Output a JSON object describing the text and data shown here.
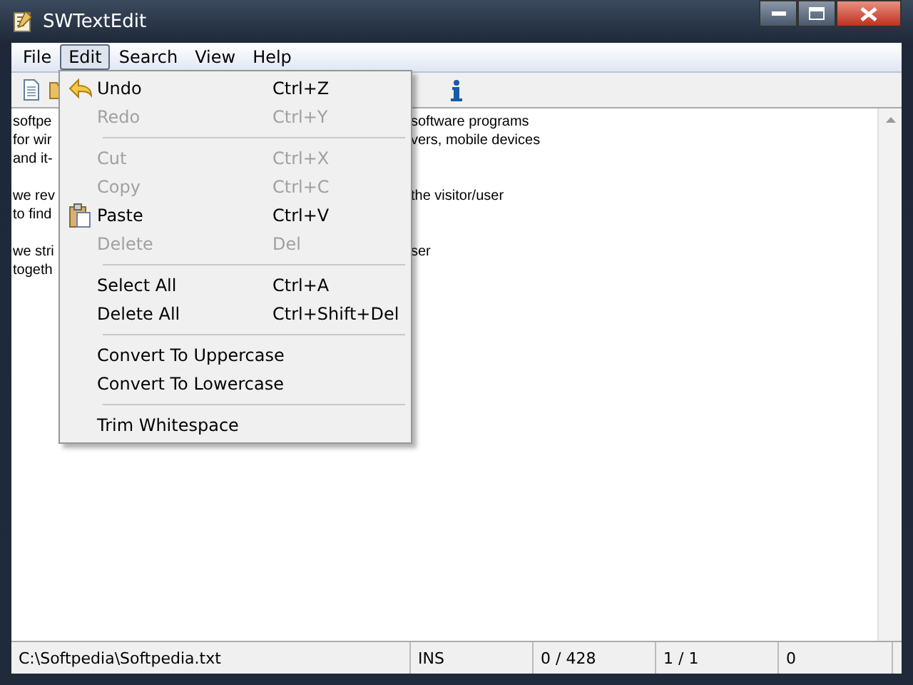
{
  "window": {
    "title": "SWTextEdit"
  },
  "menubar": [
    {
      "label": "File",
      "selected": false
    },
    {
      "label": "Edit",
      "selected": true
    },
    {
      "label": "Search",
      "selected": false
    },
    {
      "label": "View",
      "selected": false
    },
    {
      "label": "Help",
      "selected": false
    }
  ],
  "editor": {
    "lines": [
      {
        "kind": "text",
        "left": "softpe",
        "right": "software programs"
      },
      {
        "kind": "text",
        "left": "for wir",
        "right": "vers, mobile devices"
      },
      {
        "kind": "text",
        "left": "and it-"
      },
      {
        "kind": "blank"
      },
      {
        "kind": "text",
        "left": "we rev",
        "right": "the visitor/user"
      },
      {
        "kind": "text",
        "left": "to find"
      },
      {
        "kind": "blank"
      },
      {
        "kind": "text",
        "left": "we stri",
        "right": "ser"
      },
      {
        "kind": "text",
        "left": "togeth"
      }
    ]
  },
  "edit_menu": [
    {
      "kind": "item",
      "label": "Undo",
      "shortcut": "Ctrl+Z",
      "disabled": false
    },
    {
      "kind": "item",
      "label": "Redo",
      "shortcut": "Ctrl+Y",
      "disabled": true
    },
    {
      "kind": "separator"
    },
    {
      "kind": "item",
      "label": "Cut",
      "shortcut": "Ctrl+X",
      "disabled": true
    },
    {
      "kind": "item",
      "label": "Copy",
      "shortcut": "Ctrl+C",
      "disabled": true
    },
    {
      "kind": "item",
      "label": "Paste",
      "shortcut": "Ctrl+V",
      "disabled": false
    },
    {
      "kind": "item",
      "label": "Delete",
      "shortcut": "Del",
      "disabled": true
    },
    {
      "kind": "separator"
    },
    {
      "kind": "item",
      "label": "Select All",
      "shortcut": "Ctrl+A",
      "disabled": false
    },
    {
      "kind": "item",
      "label": "Delete All",
      "shortcut": "Ctrl+Shift+Del",
      "disabled": false
    },
    {
      "kind": "separator"
    },
    {
      "kind": "item",
      "label": "Convert To Uppercase",
      "disabled": false
    },
    {
      "kind": "item",
      "label": "Convert To Lowercase",
      "disabled": false
    },
    {
      "kind": "separator"
    },
    {
      "kind": "item",
      "label": "Trim Whitespace",
      "disabled": false
    }
  ],
  "status_bar": [
    "C:\\Softpedia\\Softpedia.txt",
    "INS",
    "0 / 428",
    "1 / 1",
    "0"
  ]
}
